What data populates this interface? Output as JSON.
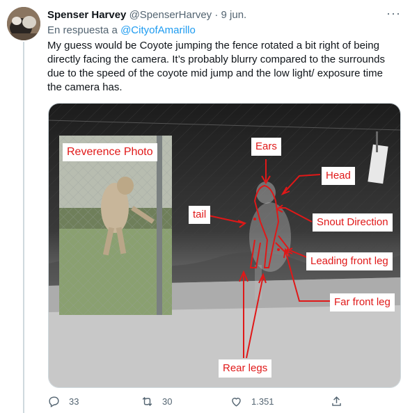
{
  "tweet": {
    "display_name": "Spenser Harvey",
    "handle": "@SpenserHarvey",
    "separator": "·",
    "date": "9 jun.",
    "more_label": "···",
    "reply_prefix": "En respuesta a",
    "reply_mention": "@CityofAmarillo",
    "text": "My guess would be Coyote jumping the fence rotated a bit right of being directly facing the camera. It’s probably blurry compared to the surrounds due to the speed of the coyote mid jump and the low light/ exposure time the camera has."
  },
  "media": {
    "reference_label": "Reverence Photo",
    "annotations": {
      "ears": "Ears",
      "head": "Head",
      "tail": "tail",
      "snout": "Snout Direction",
      "leading_leg": "Leading front leg",
      "far_leg": "Far front leg",
      "rear_legs": "Rear legs"
    },
    "annotation_color": "#e01818"
  },
  "actions": {
    "replies": "33",
    "retweets": "30",
    "likes": "1.351"
  },
  "colors": {
    "accent": "#1d9bf0",
    "muted": "#536471"
  }
}
